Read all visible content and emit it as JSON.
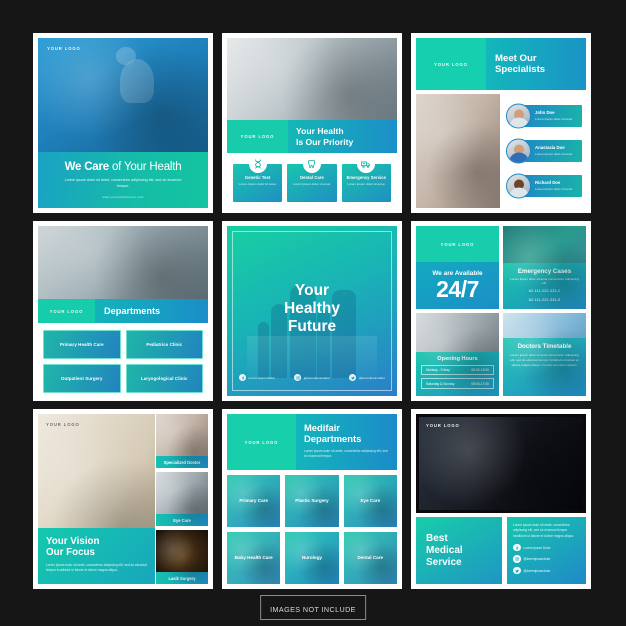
{
  "sheet": {
    "caption": "IMAGES NOT INCLUDE",
    "logo_placeholder": "YOUR LOGO",
    "colors": {
      "background": "#161616",
      "teal": "#17cdab",
      "blue": "#1a8dc8",
      "card": "#ffffff"
    }
  },
  "panels": [
    {
      "id": "we-care",
      "logo": "YOUR LOGO",
      "title_bold": "We Care",
      "title_rest": " of Your Health",
      "body": "Lorem ipsum dolor sit amet, consectetur adipiscing elit, sed do eiusmod tempor.",
      "url": "www.yourwebsitehere.com"
    },
    {
      "id": "your-health-priority",
      "logo": "YOUR LOGO",
      "title_line1": "Your Health",
      "title_line2": "Is Our Priority",
      "services": [
        {
          "icon": "dna-icon",
          "label": "Genetic Test",
          "body": "Lorem ipsum dolor sit amet."
        },
        {
          "icon": "tooth-icon",
          "label": "Dental Care",
          "body": "Lorem ipsum dolor sit amet."
        },
        {
          "icon": "ambulance-icon",
          "label": "Emergency Service",
          "body": "Lorem ipsum dolor sit amet."
        }
      ]
    },
    {
      "id": "meet-our-specialists",
      "logo": "YOUR LOGO",
      "title_line1": "Meet Our",
      "title_line2": "Specialists",
      "doctors": [
        {
          "name": "John Doe",
          "body": "Lorem ipsum dolor sit amet"
        },
        {
          "name": "Anastasia Doe",
          "body": "Lorem ipsum dolor sit amet"
        },
        {
          "name": "Richard Doe",
          "body": "Lorem ipsum dolor sit amet"
        }
      ]
    },
    {
      "id": "departments",
      "logo": "YOUR LOGO",
      "title": "Departments",
      "items": [
        "Primary Health Care",
        "Pediatrics Clinic",
        "Outpatient Surgery",
        "Laryngological Clinic"
      ]
    },
    {
      "id": "your-healthy-future",
      "title_line1": "Your",
      "title_line2": "Healthy",
      "title_line3": "Future",
      "social": [
        {
          "icon": "facebook-icon",
          "handle": "Lorem Ipsum Dolor"
        },
        {
          "icon": "instagram-icon",
          "handle": "@loremipsumdolor"
        },
        {
          "icon": "twitter-icon",
          "handle": "@loremipsumdolor"
        }
      ]
    },
    {
      "id": "available-247",
      "logo": "YOUR LOGO",
      "available_label": "We are Available",
      "available_value": "24/7",
      "emergency": {
        "title": "Emergency Cases",
        "body": "Lorem ipsum dolor sit amet consectetur adipiscing elit.",
        "phone1": "62-111-222-333-2",
        "phone2": "62-111-222-333-5"
      },
      "opening": {
        "title": "Opening Hours",
        "rows": [
          {
            "days": "Monday - Friday",
            "time": "08:00-19:00"
          },
          {
            "days": "Saturday & Sunday",
            "time": "09:00-17:00"
          }
        ]
      },
      "timetable": {
        "title": "Doctors Timetable",
        "body": "Lorem ipsum dolor sit amet consectetur adipiscing elit, sed do eiusmod tempor incididunt ut labore et dolore magna aliqua. Ut enim ad minim veniam."
      }
    },
    {
      "id": "your-vision",
      "logo": "YOUR LOGO",
      "title_line1": "Your Vision",
      "title_line2": "Our Focus",
      "body": "Lorem ipsum dolor sit amet, consectetur adipiscing elit, sed do eiusmod tempor incididunt ut labore et dolore magna aliqua.",
      "cards": [
        "Specialized Doctor",
        "Eye Care",
        "Lasik Surgery"
      ]
    },
    {
      "id": "medifair-departments",
      "logo": "YOUR LOGO",
      "title_line1": "Medifair",
      "title_line2": "Departments",
      "body": "Lorem ipsum dolor sit amet, consectetur adipiscing elit, sed do eiusmod tempor.",
      "tiles": [
        "Primary\nCare",
        "Plastic\nSurgery",
        "Eye\nCare",
        "Baby\nHealth Care",
        "Nurology",
        "Dental\nCare"
      ]
    },
    {
      "id": "best-medical-service",
      "logo": "YOUR LOGO",
      "title_line1": "Best",
      "title_line2": "Medical",
      "title_line3": "Service",
      "body": "Lorem ipsum dolor sit amet, consectetur adipiscing elit, sed do eiusmod tempor incididunt ut labore et dolore magna aliqua.",
      "social": [
        {
          "icon": "facebook-icon",
          "handle": "Lorem Ipsum Dolor"
        },
        {
          "icon": "instagram-icon",
          "handle": "@loremipsumdolor"
        },
        {
          "icon": "twitter-icon",
          "handle": "@loremipsumdolor"
        }
      ]
    }
  ]
}
